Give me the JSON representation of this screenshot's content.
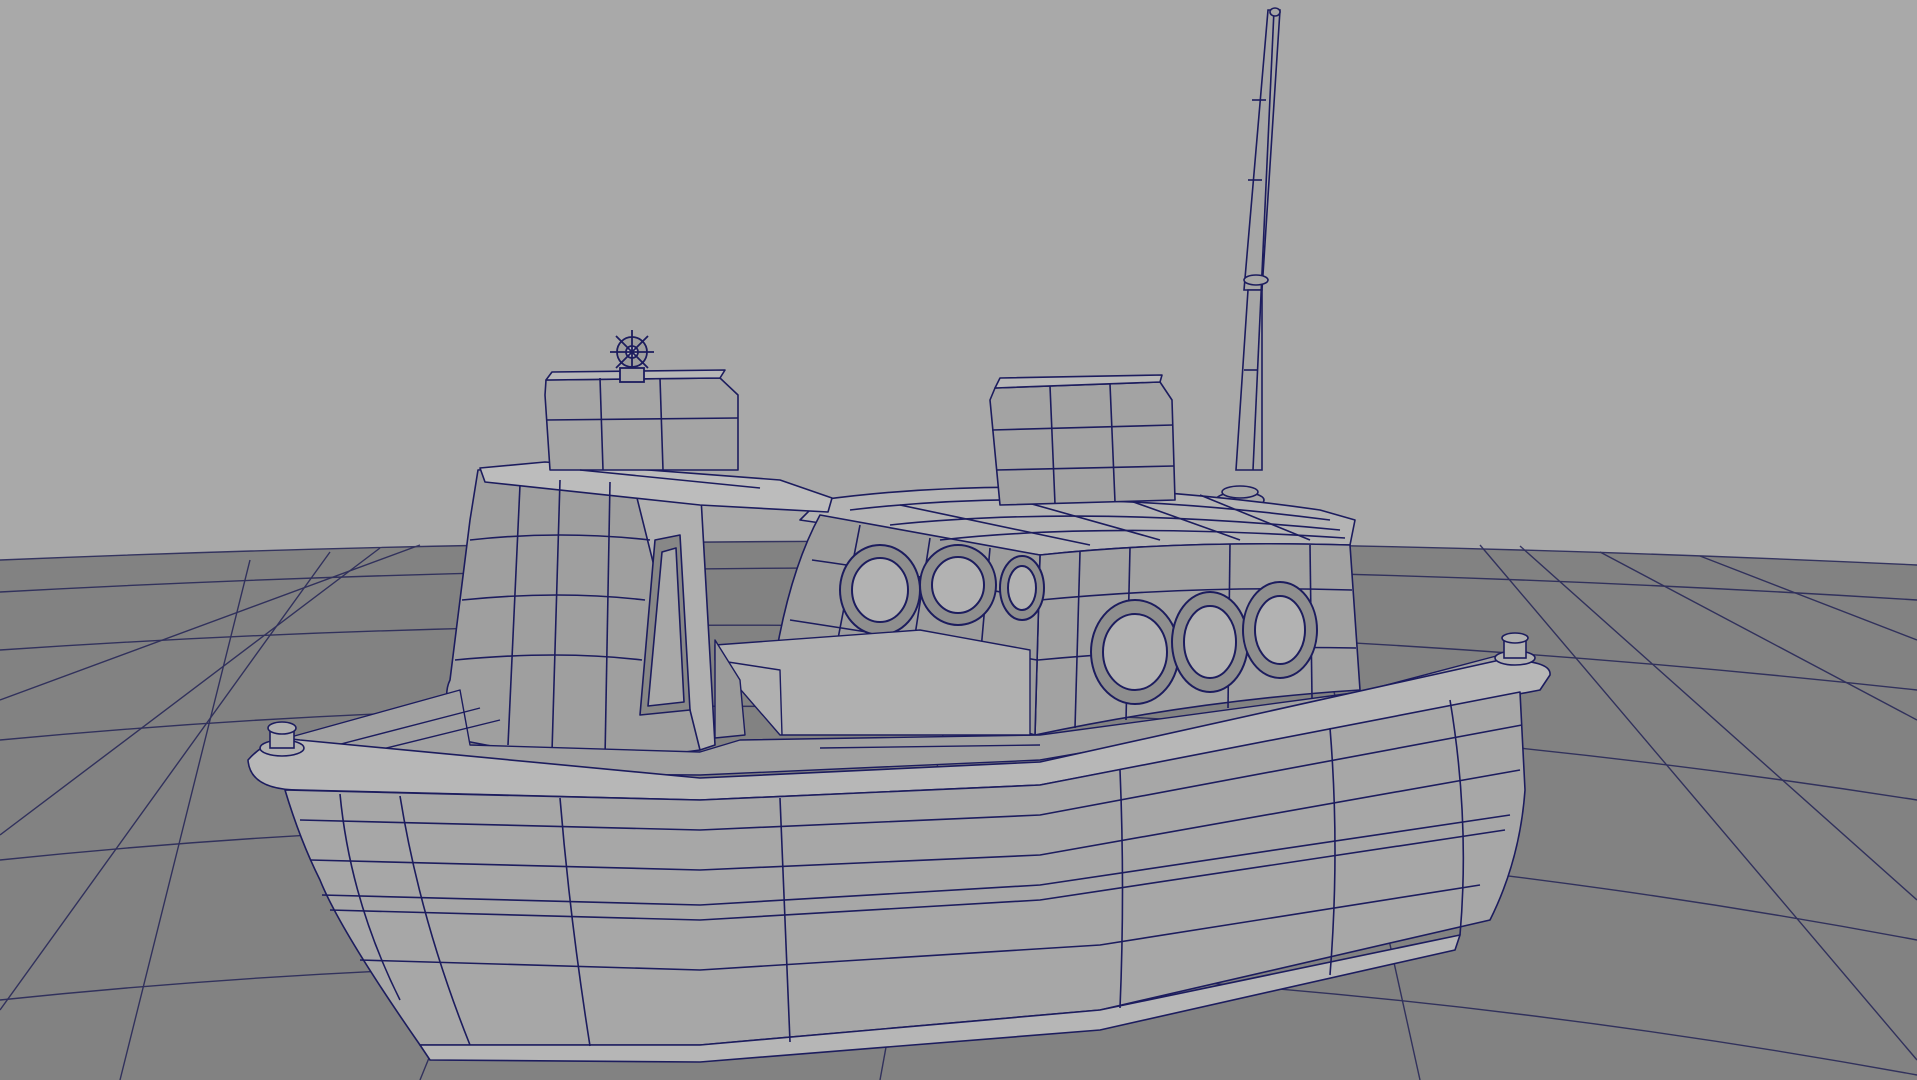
{
  "viewport": {
    "background_color": "#a9a9a9",
    "ground_color": "#828282",
    "ground_line_color": "#232356",
    "model_fill_color": "#a6a6a6",
    "model_shade_color": "#8f8f8f",
    "model_light_color": "#b9b9b9",
    "wire_color": "#1c1c5e"
  },
  "objects": [
    {
      "name": "ground-grid"
    },
    {
      "name": "boat-hull"
    },
    {
      "name": "boat-deck"
    },
    {
      "name": "wheelhouse"
    },
    {
      "name": "cabin"
    },
    {
      "name": "porthole",
      "count": 6
    },
    {
      "name": "antenna-mast"
    },
    {
      "name": "ship-wheel"
    },
    {
      "name": "mooring-bollard",
      "count": 2
    }
  ]
}
